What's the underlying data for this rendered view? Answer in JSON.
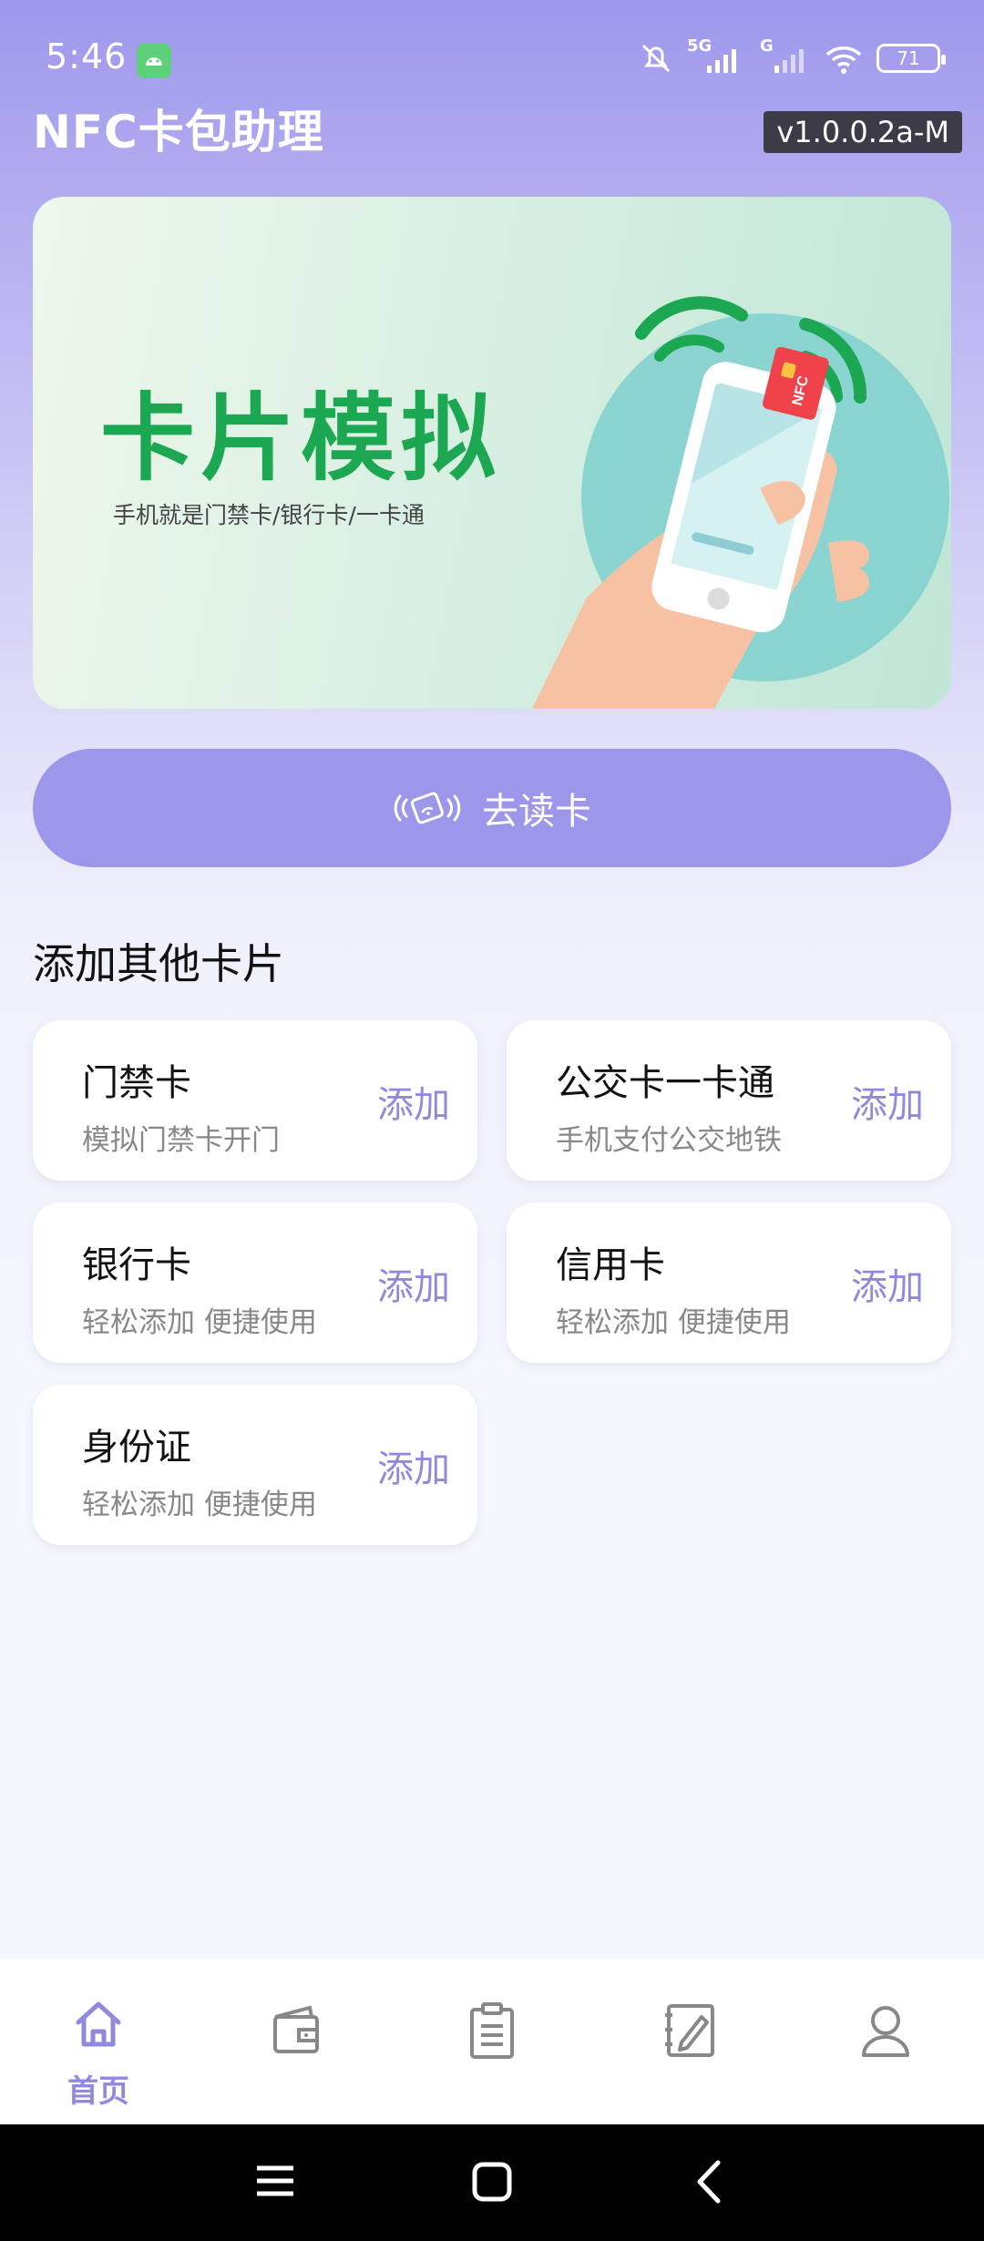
{
  "status_bar": {
    "time": "5:46",
    "battery": "71",
    "network_1": "5G",
    "network_2": "G"
  },
  "header": {
    "title": "NFC卡包助理",
    "version": "v1.0.0.2a-M"
  },
  "banner": {
    "title": "卡片模拟",
    "subtitle": "手机就是门禁卡/银行卡/一卡通",
    "card_tag": "NFC"
  },
  "read_button": {
    "label": "去读卡",
    "icon": "nfc-card-icon"
  },
  "section": {
    "title": "添加其他卡片"
  },
  "cards": [
    {
      "name": "门禁卡",
      "desc": "模拟门禁卡开门",
      "action": "添加"
    },
    {
      "name": "公交卡一卡通",
      "desc": "手机支付公交地铁",
      "action": "添加"
    },
    {
      "name": "银行卡",
      "desc": "轻松添加 便捷使用",
      "action": "添加"
    },
    {
      "name": "信用卡",
      "desc": "轻松添加 便捷使用",
      "action": "添加"
    },
    {
      "name": "身份证",
      "desc": "轻松添加 便捷使用",
      "action": "添加"
    }
  ],
  "bottom_nav": {
    "items": [
      {
        "icon": "home-icon",
        "label": "首页",
        "active": true
      },
      {
        "icon": "wallet-icon"
      },
      {
        "icon": "clipboard-icon"
      },
      {
        "icon": "edit-icon"
      },
      {
        "icon": "user-icon"
      }
    ]
  },
  "colors": {
    "accent": "#9d97ec",
    "accent_text": "#8f89e0",
    "banner_green": "#1ca752"
  }
}
